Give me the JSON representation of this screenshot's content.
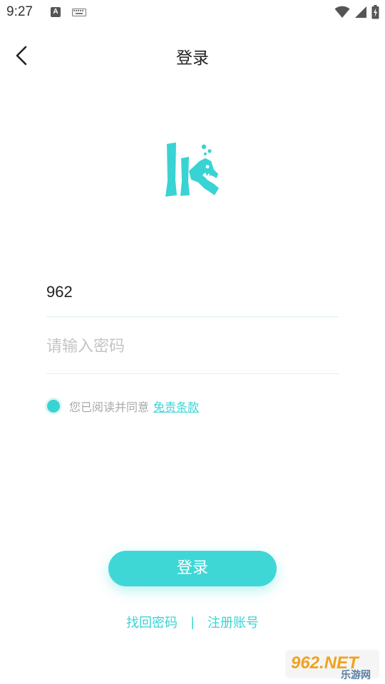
{
  "status_bar": {
    "time": "9:27",
    "a_icon_text": "A"
  },
  "nav": {
    "title": "登录"
  },
  "form": {
    "phone_value": "962",
    "password_placeholder": "请输入密码",
    "agree_text": "您已阅读并同意",
    "terms_link": "免责条款"
  },
  "actions": {
    "login_label": "登录",
    "forgot_label": "找回密码",
    "separator": "|",
    "register_label": "注册账号"
  },
  "watermark": {
    "brand": "962.NET",
    "sub": "乐游网"
  },
  "colors": {
    "accent": "#3fd7d6",
    "text": "#222222",
    "placeholder": "#c4c4c4",
    "muted": "#a9a9a9"
  }
}
